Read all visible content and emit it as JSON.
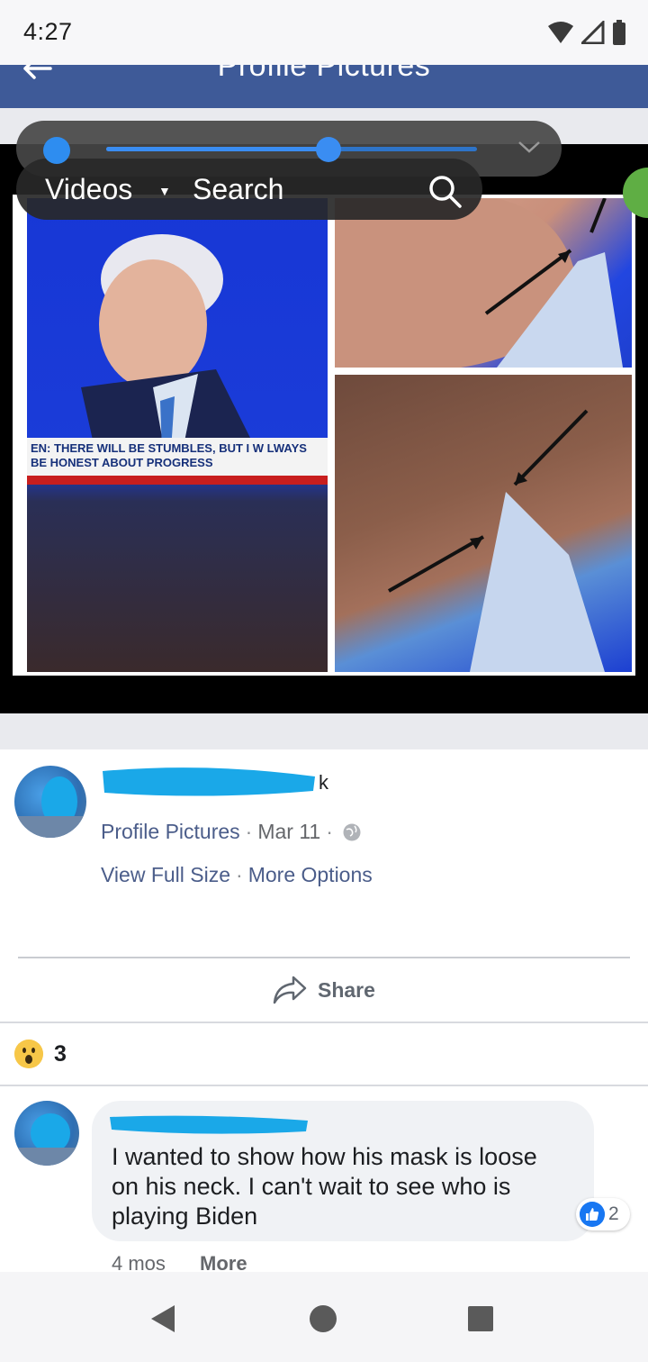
{
  "status_bar": {
    "time": "4:27"
  },
  "header": {
    "title": "Profile Pictures"
  },
  "video_overlay": {
    "videos_label": "Videos",
    "search_label": "Search",
    "progress": 0.6
  },
  "photo": {
    "banner_text": "EN: THERE WILL BE STUMBLES, BUT I W LWAYS BE HONEST ABOUT PROGRESS"
  },
  "post": {
    "name_suffix": "k",
    "album": "Profile Pictures",
    "date": "Mar 11",
    "separator": "·",
    "view_full_size": "View Full Size",
    "more_options": "More Options",
    "share_label": "Share",
    "reaction_count": "3"
  },
  "comment": {
    "text": "I wanted to show how his mask is loose on his neck. I can't wait to see who is playing Biden",
    "like_count": "2",
    "time": "4 mos",
    "more_label": "More"
  },
  "colors": {
    "header_bg": "#3e5a98",
    "link": "#4b5d8a",
    "redaction": "#1aa8e8",
    "like_blue": "#1877f2"
  }
}
